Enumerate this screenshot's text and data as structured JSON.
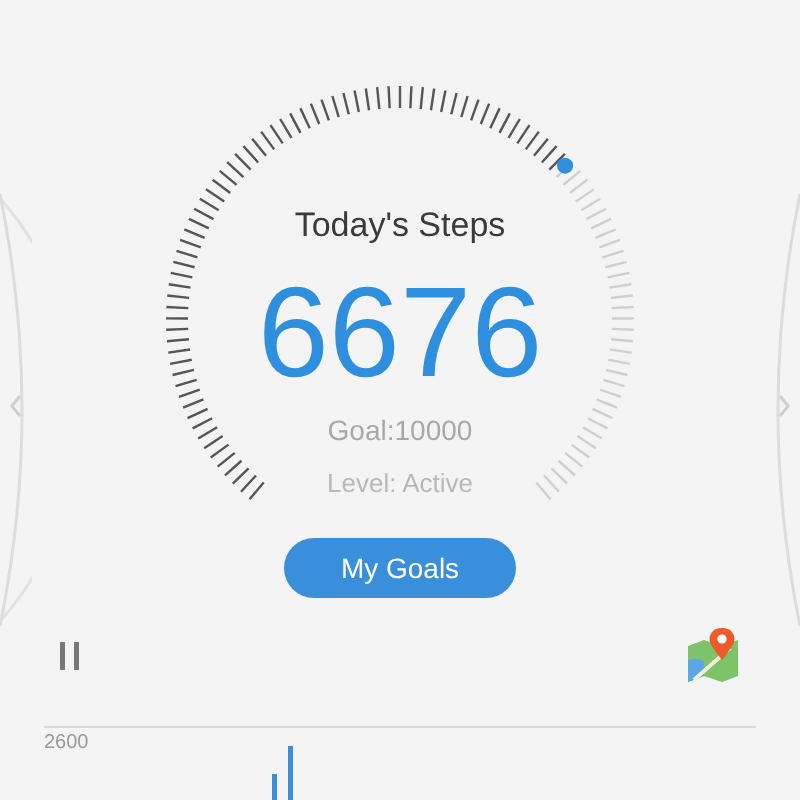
{
  "steps": {
    "title": "Today's Steps",
    "count": "6676",
    "goal": "Goal:10000",
    "level_text": "Level: Active"
  },
  "goals_button": "My Goals",
  "chart": {
    "max_label": "2600"
  }
}
